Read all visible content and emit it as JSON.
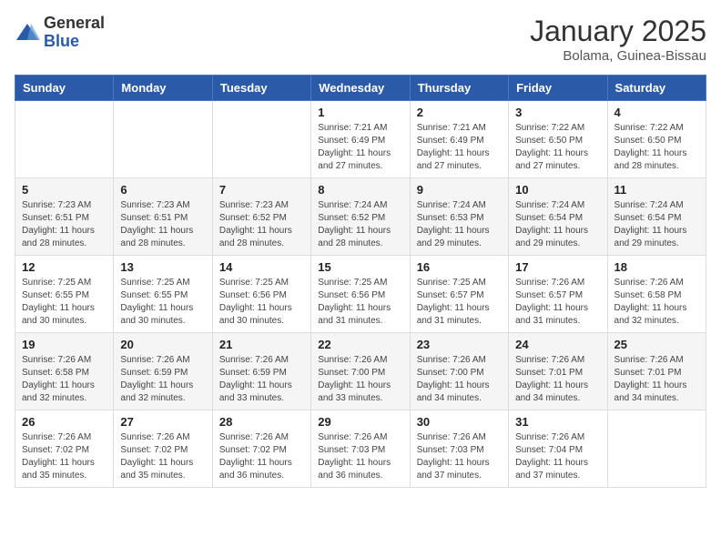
{
  "header": {
    "logo_general": "General",
    "logo_blue": "Blue",
    "month_title": "January 2025",
    "location": "Bolama, Guinea-Bissau"
  },
  "days_of_week": [
    "Sunday",
    "Monday",
    "Tuesday",
    "Wednesday",
    "Thursday",
    "Friday",
    "Saturday"
  ],
  "weeks": [
    [
      {
        "day": "",
        "info": ""
      },
      {
        "day": "",
        "info": ""
      },
      {
        "day": "",
        "info": ""
      },
      {
        "day": "1",
        "info": "Sunrise: 7:21 AM\nSunset: 6:49 PM\nDaylight: 11 hours and 27 minutes."
      },
      {
        "day": "2",
        "info": "Sunrise: 7:21 AM\nSunset: 6:49 PM\nDaylight: 11 hours and 27 minutes."
      },
      {
        "day": "3",
        "info": "Sunrise: 7:22 AM\nSunset: 6:50 PM\nDaylight: 11 hours and 27 minutes."
      },
      {
        "day": "4",
        "info": "Sunrise: 7:22 AM\nSunset: 6:50 PM\nDaylight: 11 hours and 28 minutes."
      }
    ],
    [
      {
        "day": "5",
        "info": "Sunrise: 7:23 AM\nSunset: 6:51 PM\nDaylight: 11 hours and 28 minutes."
      },
      {
        "day": "6",
        "info": "Sunrise: 7:23 AM\nSunset: 6:51 PM\nDaylight: 11 hours and 28 minutes."
      },
      {
        "day": "7",
        "info": "Sunrise: 7:23 AM\nSunset: 6:52 PM\nDaylight: 11 hours and 28 minutes."
      },
      {
        "day": "8",
        "info": "Sunrise: 7:24 AM\nSunset: 6:52 PM\nDaylight: 11 hours and 28 minutes."
      },
      {
        "day": "9",
        "info": "Sunrise: 7:24 AM\nSunset: 6:53 PM\nDaylight: 11 hours and 29 minutes."
      },
      {
        "day": "10",
        "info": "Sunrise: 7:24 AM\nSunset: 6:54 PM\nDaylight: 11 hours and 29 minutes."
      },
      {
        "day": "11",
        "info": "Sunrise: 7:24 AM\nSunset: 6:54 PM\nDaylight: 11 hours and 29 minutes."
      }
    ],
    [
      {
        "day": "12",
        "info": "Sunrise: 7:25 AM\nSunset: 6:55 PM\nDaylight: 11 hours and 30 minutes."
      },
      {
        "day": "13",
        "info": "Sunrise: 7:25 AM\nSunset: 6:55 PM\nDaylight: 11 hours and 30 minutes."
      },
      {
        "day": "14",
        "info": "Sunrise: 7:25 AM\nSunset: 6:56 PM\nDaylight: 11 hours and 30 minutes."
      },
      {
        "day": "15",
        "info": "Sunrise: 7:25 AM\nSunset: 6:56 PM\nDaylight: 11 hours and 31 minutes."
      },
      {
        "day": "16",
        "info": "Sunrise: 7:25 AM\nSunset: 6:57 PM\nDaylight: 11 hours and 31 minutes."
      },
      {
        "day": "17",
        "info": "Sunrise: 7:26 AM\nSunset: 6:57 PM\nDaylight: 11 hours and 31 minutes."
      },
      {
        "day": "18",
        "info": "Sunrise: 7:26 AM\nSunset: 6:58 PM\nDaylight: 11 hours and 32 minutes."
      }
    ],
    [
      {
        "day": "19",
        "info": "Sunrise: 7:26 AM\nSunset: 6:58 PM\nDaylight: 11 hours and 32 minutes."
      },
      {
        "day": "20",
        "info": "Sunrise: 7:26 AM\nSunset: 6:59 PM\nDaylight: 11 hours and 32 minutes."
      },
      {
        "day": "21",
        "info": "Sunrise: 7:26 AM\nSunset: 6:59 PM\nDaylight: 11 hours and 33 minutes."
      },
      {
        "day": "22",
        "info": "Sunrise: 7:26 AM\nSunset: 7:00 PM\nDaylight: 11 hours and 33 minutes."
      },
      {
        "day": "23",
        "info": "Sunrise: 7:26 AM\nSunset: 7:00 PM\nDaylight: 11 hours and 34 minutes."
      },
      {
        "day": "24",
        "info": "Sunrise: 7:26 AM\nSunset: 7:01 PM\nDaylight: 11 hours and 34 minutes."
      },
      {
        "day": "25",
        "info": "Sunrise: 7:26 AM\nSunset: 7:01 PM\nDaylight: 11 hours and 34 minutes."
      }
    ],
    [
      {
        "day": "26",
        "info": "Sunrise: 7:26 AM\nSunset: 7:02 PM\nDaylight: 11 hours and 35 minutes."
      },
      {
        "day": "27",
        "info": "Sunrise: 7:26 AM\nSunset: 7:02 PM\nDaylight: 11 hours and 35 minutes."
      },
      {
        "day": "28",
        "info": "Sunrise: 7:26 AM\nSunset: 7:02 PM\nDaylight: 11 hours and 36 minutes."
      },
      {
        "day": "29",
        "info": "Sunrise: 7:26 AM\nSunset: 7:03 PM\nDaylight: 11 hours and 36 minutes."
      },
      {
        "day": "30",
        "info": "Sunrise: 7:26 AM\nSunset: 7:03 PM\nDaylight: 11 hours and 37 minutes."
      },
      {
        "day": "31",
        "info": "Sunrise: 7:26 AM\nSunset: 7:04 PM\nDaylight: 11 hours and 37 minutes."
      },
      {
        "day": "",
        "info": ""
      }
    ]
  ]
}
